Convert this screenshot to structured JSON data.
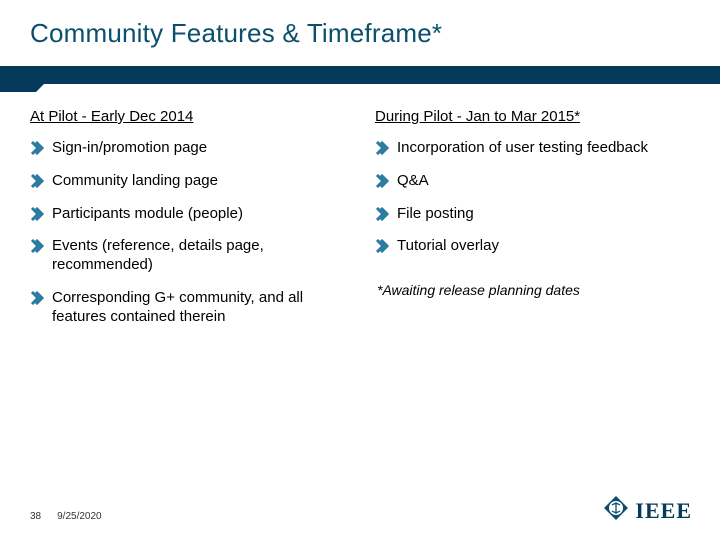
{
  "title": "Community Features & Timeframe*",
  "left": {
    "heading": "At Pilot - Early Dec 2014",
    "items": [
      "Sign-in/promotion page",
      "Community landing page",
      "Participants module (people)",
      "Events (reference, details page, recommended)",
      "Corresponding G+ community, and all features contained therein"
    ]
  },
  "right": {
    "heading": "During Pilot - Jan to Mar 2015*",
    "items": [
      "Incorporation of user testing feedback",
      "Q&A",
      "File posting",
      "Tutorial overlay"
    ],
    "footnote": "*Awaiting release planning dates"
  },
  "footer": {
    "page": "38",
    "date": "9/25/2020"
  },
  "logo": {
    "text": "IEEE"
  },
  "colors": {
    "accent": "#2b7aa1"
  }
}
